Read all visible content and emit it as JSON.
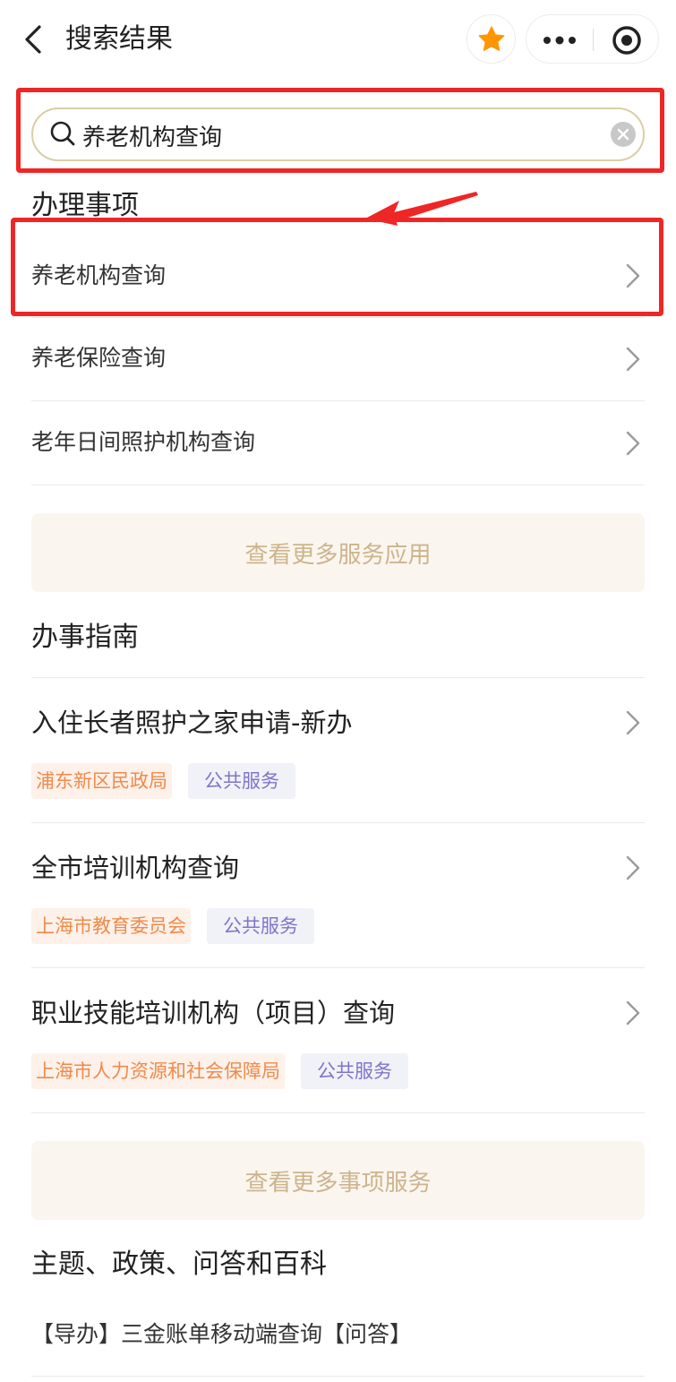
{
  "header": {
    "title": "搜索结果",
    "back_icon": "chevron-left-icon",
    "star_icon": "star-icon",
    "more_icon": "more-dots-icon",
    "close_icon": "target-circle-icon",
    "star_color": "#ff9500"
  },
  "search": {
    "value": "养老机构查询",
    "placeholder": "",
    "icon": "search-icon",
    "clear_icon": "clear-icon"
  },
  "sections": {
    "matters": {
      "title": "办理事项",
      "items": [
        {
          "label": "养老机构查询"
        },
        {
          "label": "养老保险查询"
        },
        {
          "label": "老年日间照护机构查询"
        }
      ],
      "more_label": "查看更多服务应用"
    },
    "guide": {
      "title": "办事指南",
      "items": [
        {
          "title": "入住长者照护之家申请-新办",
          "dept": "浦东新区民政局",
          "type": "公共服务"
        },
        {
          "title": "全市培训机构查询",
          "dept": "上海市教育委员会",
          "type": "公共服务"
        },
        {
          "title": "职业技能培训机构（项目）查询",
          "dept": "上海市人力资源和社会保障局",
          "type": "公共服务"
        }
      ],
      "more_label": "查看更多事项服务"
    },
    "topics": {
      "title": "主题、政策、问答和百科",
      "items": [
        {
          "label": "【导办】三金账单移动端查询【问答】"
        }
      ]
    }
  },
  "colors": {
    "annotation_red": "#ee2626",
    "search_border": "#d9cfa4",
    "more_button_bg": "#faf6ef",
    "more_button_text": "#cdb48c",
    "dept_tag_text": "#f08a4b",
    "service_tag_text": "#8075c8"
  }
}
